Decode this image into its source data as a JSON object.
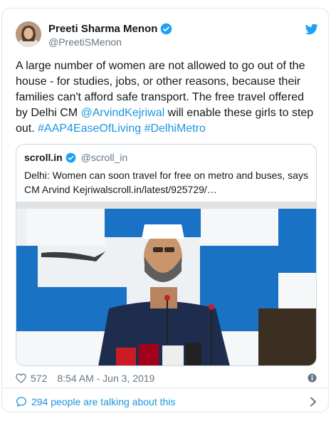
{
  "tweet": {
    "author": {
      "name": "Preeti Sharma Menon",
      "handle": "@PreetiSMenon"
    },
    "text_parts": [
      "A large number of women are not allowed to go out of the house - for studies, jobs, or other reasons, because their families can't afford safe transport. The free travel offered by Delhi CM ",
      "@ArvindKejriwal",
      " will enable these girls to step out. ",
      "#AAP4EaseOfLiving",
      " ",
      "#DelhiMetro"
    ],
    "likes": "572",
    "timestamp": "8:54 AM - Jun 3, 2019",
    "talking": "294 people are talking about this"
  },
  "quoted": {
    "name": "scroll.in",
    "handle": "@scroll_in",
    "text": "Delhi: Women can soon travel for free on metro and buses, says CM Arvind Kejriwalscroll.in/latest/925729/…"
  },
  "colors": {
    "link": "#1b95e0",
    "twitter_blue": "#1da1f2",
    "text": "#14171a",
    "muted": "#657786",
    "border": "#e1e8ed"
  },
  "icons": {
    "logo": "twitter-bird-icon",
    "verified": "verified-badge-icon",
    "like": "heart-icon",
    "info": "info-icon",
    "talk": "speech-bubble-icon",
    "more": "chevron-right-icon"
  }
}
